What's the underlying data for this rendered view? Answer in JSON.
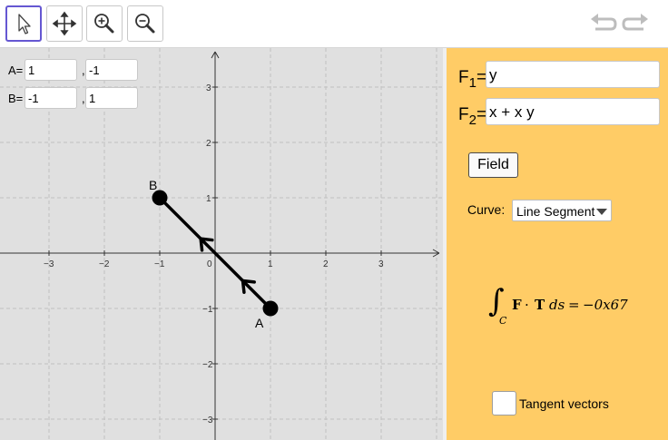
{
  "toolbar": {
    "tools": [
      {
        "name": "move",
        "icon": "arrow-cursor-icon",
        "active": true
      },
      {
        "name": "move-graphics-view",
        "icon": "move-arrows-icon",
        "active": false
      },
      {
        "name": "zoom-in",
        "icon": "zoom-in-icon",
        "active": false
      },
      {
        "name": "zoom-out",
        "icon": "zoom-out-icon",
        "active": false
      }
    ],
    "undo_icon": "undo-icon",
    "redo_icon": "redo-icon",
    "active_color": "#6557d2"
  },
  "graphics": {
    "background": "#e0e0e0",
    "inputs": {
      "a_label": "A=",
      "a_x": "1",
      "a_y": "-1",
      "b_label": "B=",
      "b_x": "-1",
      "b_y": "1",
      "separator": ","
    },
    "x_ticks": [
      "−3",
      "−2",
      "−1",
      "0",
      "1",
      "2",
      "3"
    ],
    "y_ticks": [
      "3",
      "2",
      "1",
      "−1",
      "−2",
      "−3"
    ],
    "points": [
      {
        "label": "A",
        "x": 1,
        "y": -1
      },
      {
        "label": "B",
        "x": -1,
        "y": 1
      }
    ],
    "segment_color": "#000000"
  },
  "panel": {
    "background": "#ffcc66",
    "f1": {
      "prefix": "F",
      "sub": "1",
      "eq": "=",
      "value": "y"
    },
    "f2": {
      "prefix": "F",
      "sub": "2",
      "eq": "=",
      "value": "x + x y"
    },
    "field_button": "Field",
    "curve_label": "Curve:",
    "curve_selected": "Line Segment",
    "integral": {
      "symbol": "∫",
      "subscript": "C",
      "bold_f": "F",
      "dot": "·",
      "bold_t": "T",
      "ds": "ds",
      "equals": "=",
      "result": "−0x67"
    },
    "tangent_label": "Tangent vectors",
    "tangent_checked": false
  }
}
